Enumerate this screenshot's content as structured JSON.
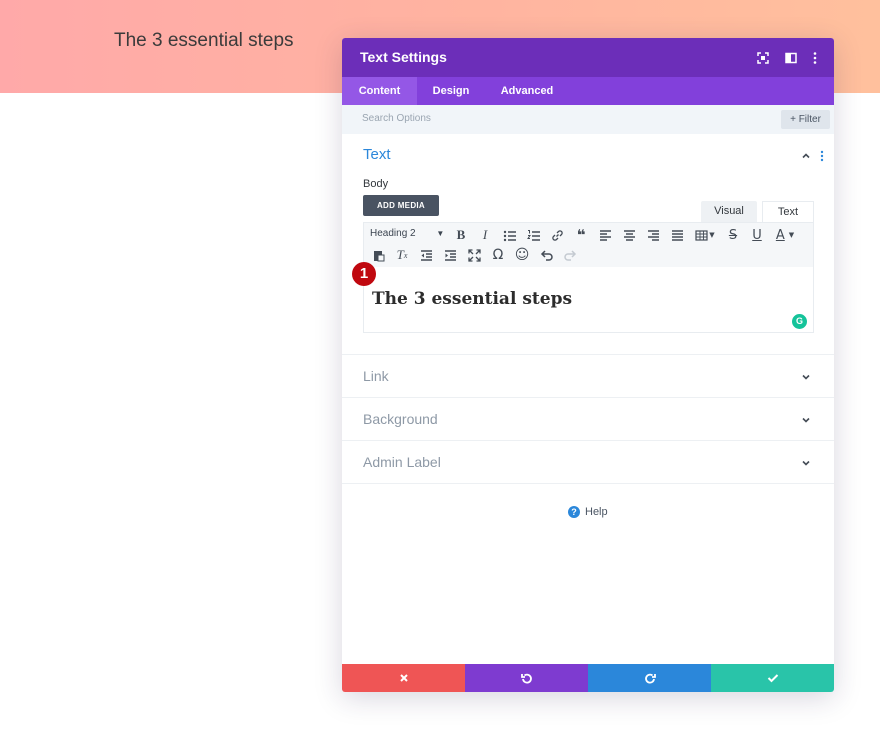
{
  "hero": {
    "title": "The 3 essential steps"
  },
  "modal": {
    "title": "Text Settings",
    "header_icons": [
      "fullscreen-icon",
      "split-view-icon",
      "more-options-icon"
    ],
    "tabs": [
      {
        "label": "Content",
        "active": true
      },
      {
        "label": "Design",
        "active": false
      },
      {
        "label": "Advanced",
        "active": false
      }
    ],
    "search": {
      "placeholder": "Search Options"
    },
    "filter": {
      "icon": "plus-icon",
      "label": "Filter"
    },
    "section": {
      "title": "Text",
      "body_label": "Body",
      "add_media": "ADD MEDIA",
      "view_tabs": [
        "Visual",
        "Text"
      ],
      "format_select": "Heading 2",
      "editor_content": "The 3 essential steps",
      "badge": "1",
      "grammarly": "G"
    },
    "accordions": [
      {
        "label": "Link"
      },
      {
        "label": "Background"
      },
      {
        "label": "Admin Label"
      }
    ],
    "help": {
      "label": "Help",
      "icon": "?"
    },
    "footer": [
      {
        "name": "discard-button",
        "icon": "close-icon",
        "color": "#ef5555"
      },
      {
        "name": "undo-button",
        "icon": "undo-icon",
        "color": "#7e3bd0"
      },
      {
        "name": "redo-button",
        "icon": "redo-icon",
        "color": "#2b87da"
      },
      {
        "name": "save-button",
        "icon": "check-icon",
        "color": "#29c4a9"
      }
    ]
  }
}
